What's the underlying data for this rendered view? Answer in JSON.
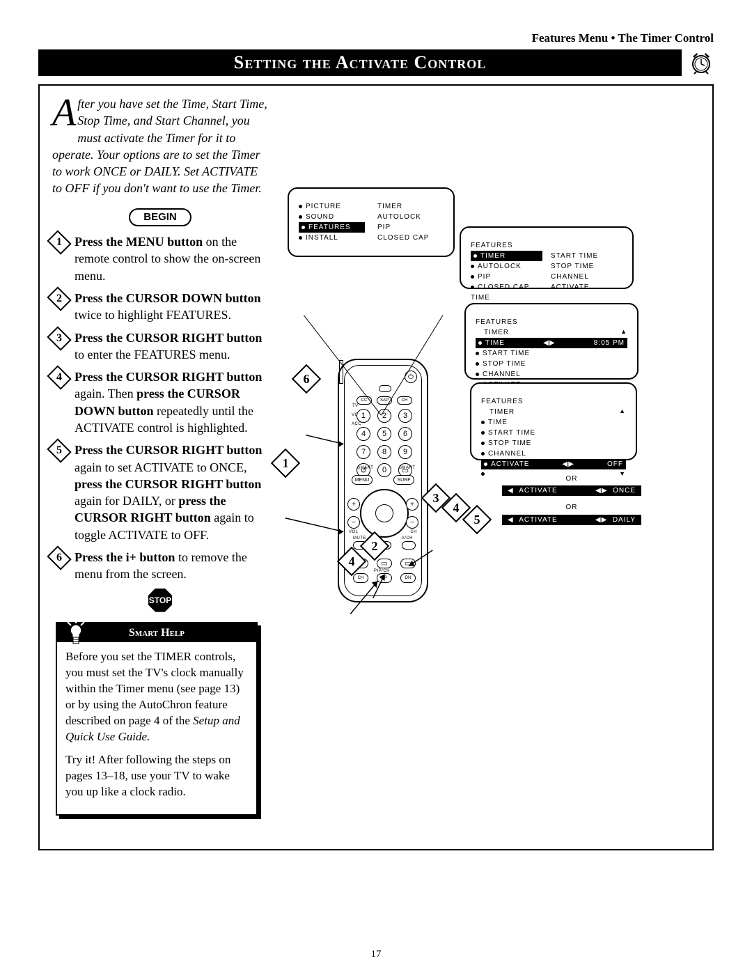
{
  "running_head": "Features Menu • The Timer Control",
  "title": "Setting the Activate Control",
  "intro_dropcap": "A",
  "intro_rest": "fter you have set the Time, Start Time, Stop Time, and Start Channel, you must activate the Timer for it to operate. Your options are to set the Timer to work ONCE or DAILY. Set ACTIVATE to OFF if you don't want to use the Timer.",
  "begin_label": "BEGIN",
  "steps": [
    {
      "n": "1",
      "bold": "Press the MENU button",
      "rest": " on the remote control to show the on-screen menu."
    },
    {
      "n": "2",
      "bold": "Press the CURSOR DOWN button",
      "rest": " twice to highlight FEATURES."
    },
    {
      "n": "3",
      "bold": "Press the CURSOR RIGHT button",
      "rest": " to enter the FEATURES menu."
    },
    {
      "n": "4",
      "bold": "Press the CURSOR RIGHT button",
      "rest": " again. Then ",
      "bold2": "press the CURSOR DOWN button",
      "rest2": " repeatedly until the ACTIVATE control is highlighted."
    },
    {
      "n": "5",
      "bold": "Press the CURSOR RIGHT button",
      "rest": " again to set ACTIVATE to ONCE, ",
      "bold2": "press the CURSOR RIGHT button",
      "rest2": " again for DAILY, or ",
      "bold3": "press the CURSOR RIGHT button",
      "rest3": " again to toggle ACTIVATE to OFF."
    },
    {
      "n": "6",
      "bold": "Press the i+ button",
      "rest": " to remove the menu from the screen."
    }
  ],
  "stop_label": "STOP",
  "smart_help": {
    "title": "Smart Help",
    "p1": "Before you set the TIMER controls, you must set the TV's clock manually within the Timer menu (see page 13) or by using the AutoChron feature described on page 4 of the ",
    "p1_em": "Setup and Quick Use Guide.",
    "p2": "Try it! After following the steps on pages 13–18, use your TV to wake you up like a clock radio."
  },
  "menus": {
    "main": {
      "left": [
        "PICTURE",
        "SOUND",
        "FEATURES",
        "INSTALL"
      ],
      "right": [
        "TIMER",
        "AUTOLOCK",
        "PIP",
        "CLOSED CAP"
      ],
      "highlight_index": 2
    },
    "features": {
      "heading": "FEATURES",
      "left": [
        "TIMER",
        "AUTOLOCK",
        "PIP",
        "CLOSED CAP"
      ],
      "right": [
        "TIME",
        "START TIME",
        "STOP TIME",
        "CHANNEL",
        "ACTIVATE"
      ],
      "highlight_index": 0
    },
    "timer_first": {
      "heading": "FEATURES",
      "subheading": "TIMER",
      "rows": [
        "TIME",
        "START TIME",
        "STOP TIME",
        "CHANNEL",
        "ACTIVATE"
      ],
      "highlight_index": 0,
      "highlight_value": "8:05 PM"
    },
    "timer_activate": {
      "heading": "FEATURES",
      "subheading": "TIMER",
      "rows": [
        "TIME",
        "START TIME",
        "STOP TIME",
        "CHANNEL",
        "ACTIVATE"
      ],
      "highlight_index": 4,
      "highlight_value": "OFF"
    },
    "activate_once": {
      "label": "ACTIVATE",
      "value": "ONCE"
    },
    "activate_daily": {
      "label": "ACTIVATE",
      "value": "DAILY"
    },
    "or_label": "OR"
  },
  "remote": {
    "menu": "MENU",
    "surf": "SURF",
    "row_labels": [
      "CC",
      "SAP",
      "CH"
    ],
    "sidebar_labels": [
      "TV",
      "VCR",
      "ACC"
    ],
    "smart_left": "SMART",
    "smart_right": "SMART",
    "vol": "VOL",
    "ch": "CH",
    "mute_row": [
      "MUTE",
      "",
      "A/CH"
    ],
    "pip_heading": "PIP/CH",
    "bottom_row": [
      "CH",
      "UP",
      "DN"
    ],
    "numpad": [
      "1",
      "2",
      "3",
      "4",
      "5",
      "6",
      "7",
      "8",
      "9",
      "",
      "0",
      ""
    ]
  },
  "callouts": [
    "1",
    "2",
    "3",
    "4",
    "5",
    "6"
  ],
  "page_number": "17"
}
